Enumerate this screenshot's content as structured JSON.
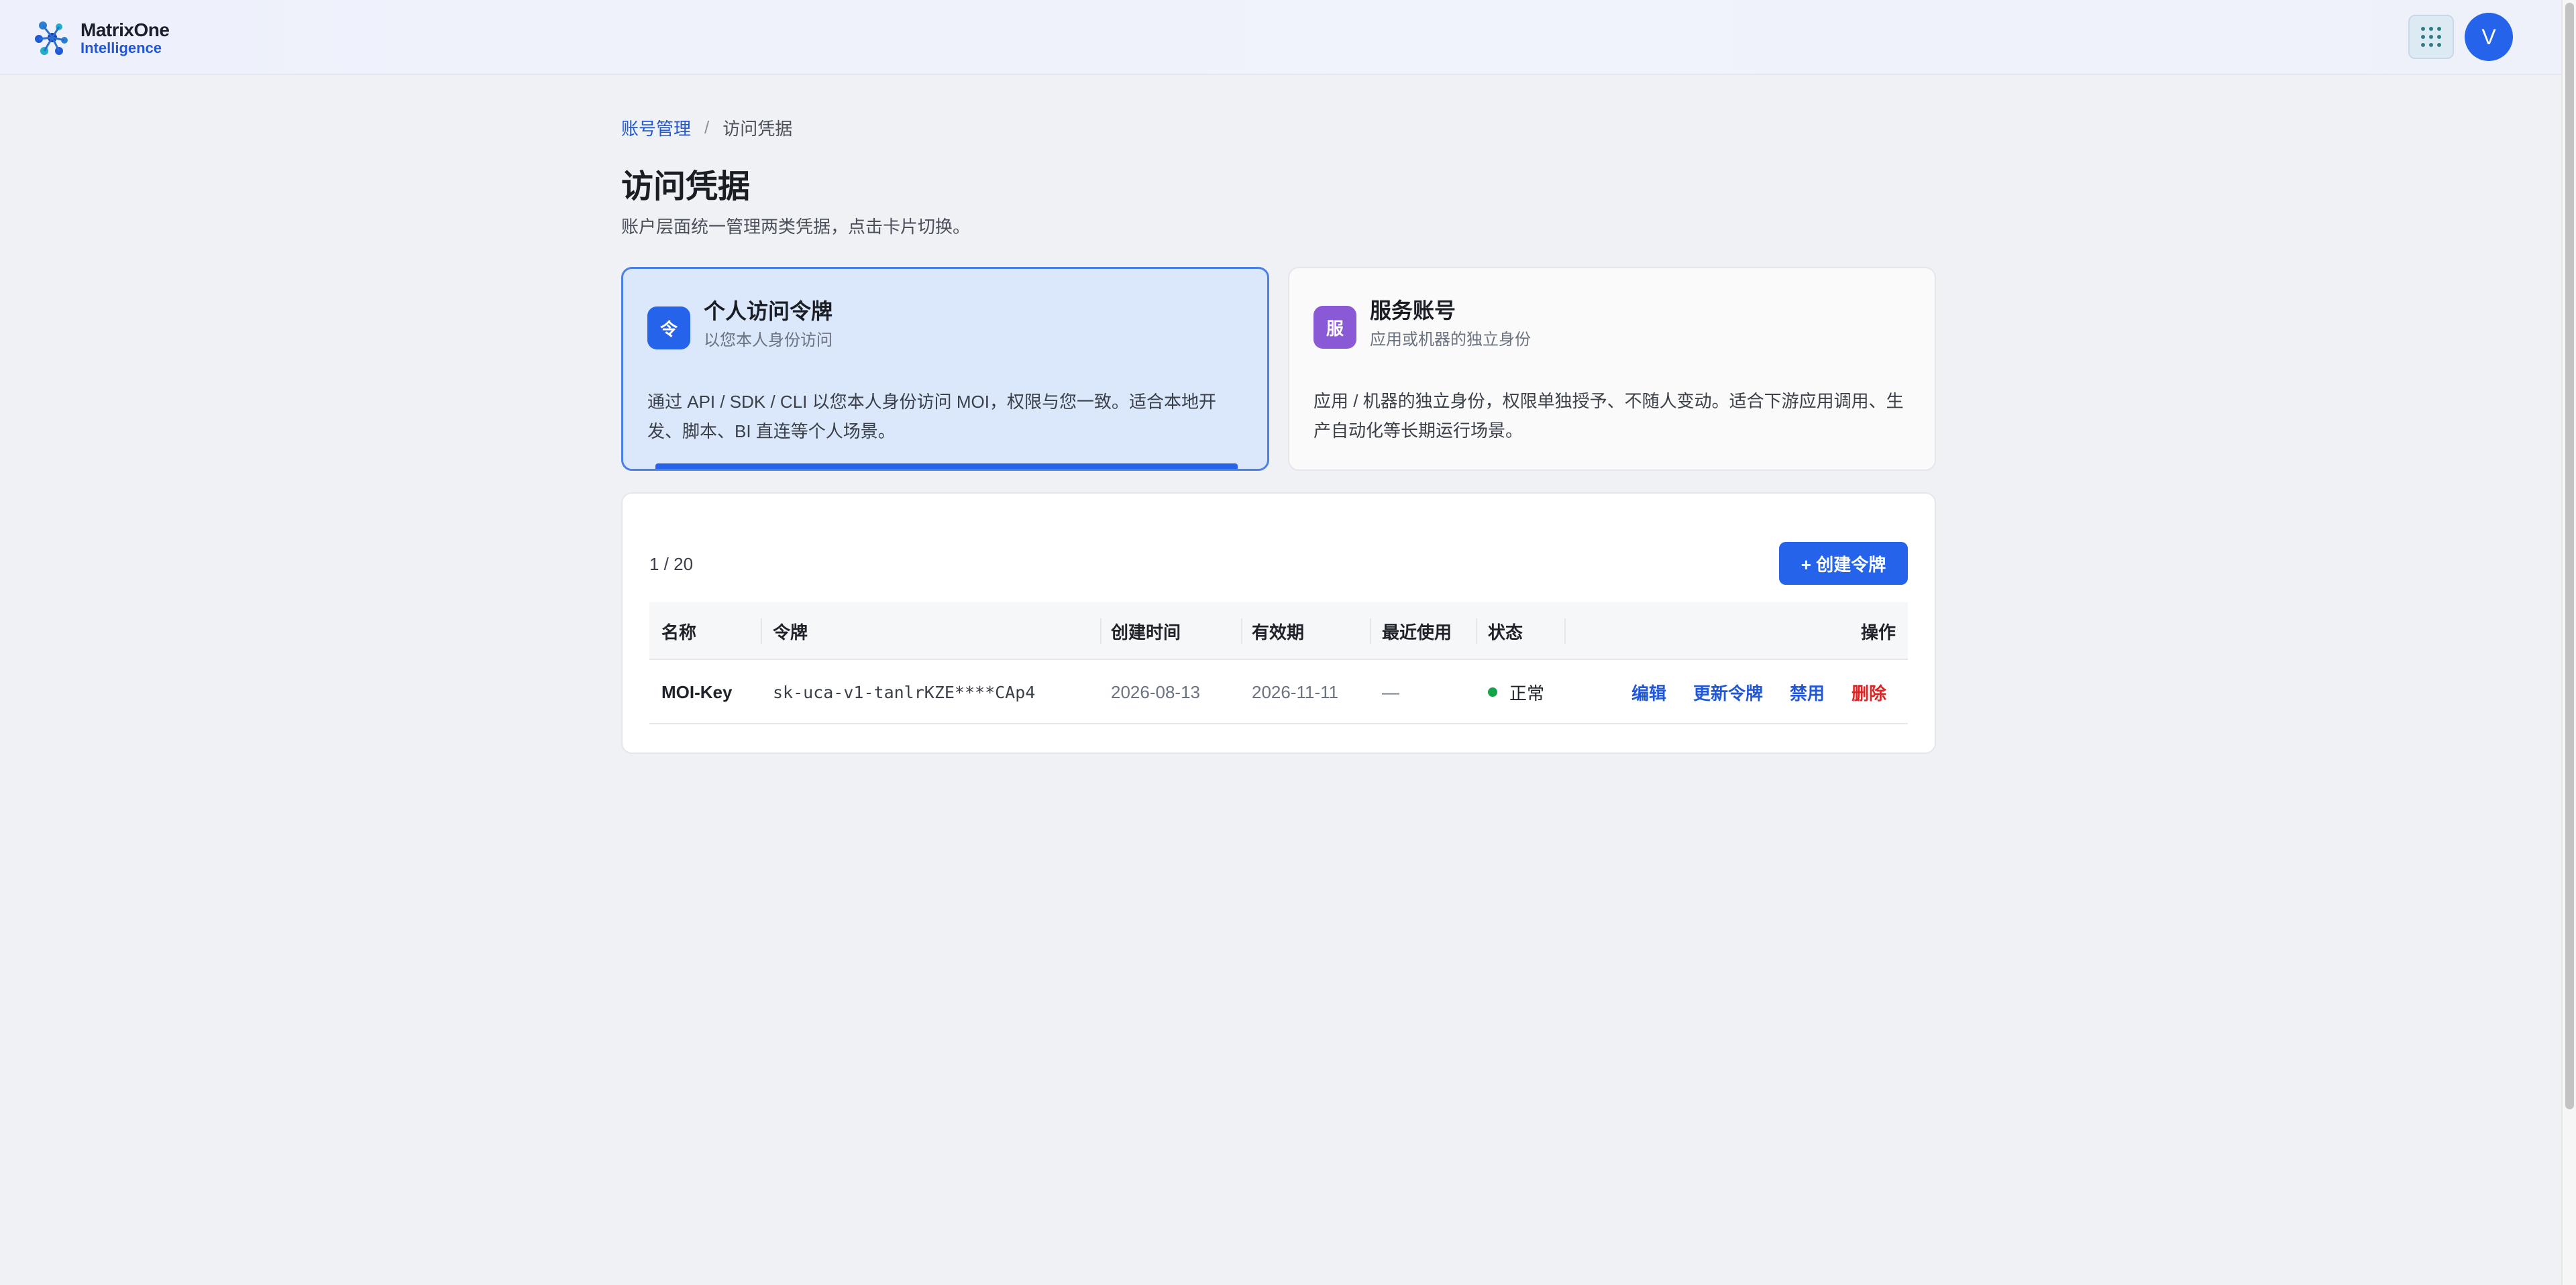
{
  "app": {
    "logo_line1": "MatrixOne",
    "logo_line2": "Intelligence",
    "avatar_letter": "V",
    "accent": "#2563eb"
  },
  "breadcrumb": {
    "parent": "账号管理",
    "separator": "/",
    "current": "访问凭据"
  },
  "page": {
    "title": "访问凭据",
    "subtitle": "账户层面统一管理两类凭据，点击卡片切换。"
  },
  "cards": [
    {
      "icon_char": "令",
      "title": "个人访问令牌",
      "subtitle": "以您本人身份访问",
      "description": "通过 API / SDK / CLI 以您本人身份访问 MOI，权限与您一致。适合本地开发、脚本、BI 直连等个人场景。",
      "active": true
    },
    {
      "icon_char": "服",
      "title": "服务账号",
      "subtitle": "应用或机器的独立身份",
      "description": "应用 / 机器的独立身份，权限单独授予、不随人变动。适合下游应用调用、生产自动化等长期运行场景。",
      "active": false
    }
  ],
  "tokens": {
    "count_label": "1 / 20",
    "create_button": "+ 创建令牌",
    "columns": [
      "名称",
      "令牌",
      "创建时间",
      "有效期",
      "最近使用",
      "状态",
      "操作"
    ],
    "rows": [
      {
        "name": "MOI-Key",
        "token": "sk-uca-v1-tanlrKZE****CAp4",
        "created": "2026-08-13",
        "expires": "2026-11-11",
        "last_used": "—",
        "status": "正常",
        "status_color": "#16a34a",
        "actions": {
          "edit": "编辑",
          "renew": "更新令牌",
          "disable": "禁用",
          "delete": "删除"
        }
      }
    ]
  }
}
